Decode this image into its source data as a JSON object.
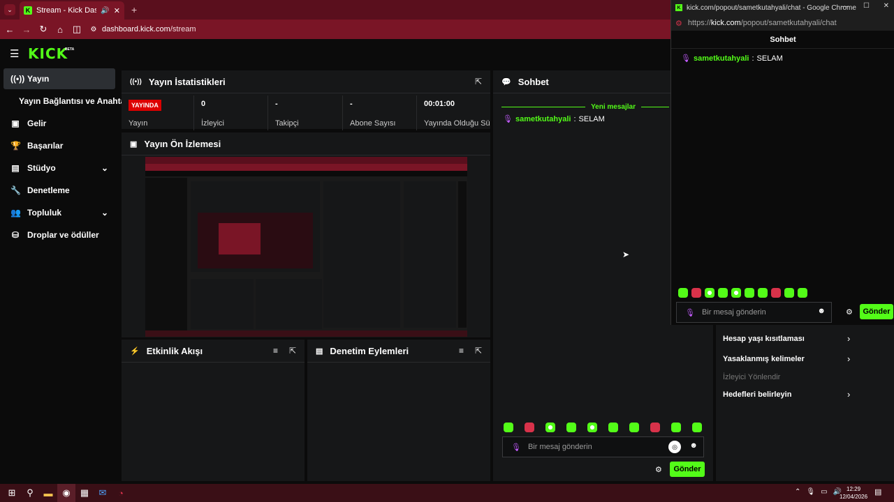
{
  "browser": {
    "tab_title": "Stream - Kick Dashboard",
    "url_domain": "dashboard.kick.com",
    "url_path": "/stream"
  },
  "popout": {
    "window_title": "kick.com/popout/sametkutahyali/chat - Google Chrome",
    "url_prefix": "https://",
    "url_domain": "kick.com",
    "url_path": "/popout/sametkutahyali/chat",
    "header": "Sohbet",
    "messages": [
      {
        "user": "sametkutahyali",
        "text": "SELAM"
      }
    ],
    "input_placeholder": "Bir mesaj gönderin",
    "send_label": "Gönder"
  },
  "header": {
    "logo": "KICK",
    "beta": "BETA"
  },
  "sidebar": {
    "items": [
      {
        "label": "Yayın",
        "icon": "broadcast-icon"
      },
      {
        "label": "Yayın Bağlantısı ve Anahtarı",
        "icon": ""
      },
      {
        "label": "Gelir",
        "icon": "revenue-icon"
      },
      {
        "label": "Başarılar",
        "icon": "trophy-icon"
      },
      {
        "label": "Stüdyo",
        "icon": "studio-icon"
      },
      {
        "label": "Denetleme",
        "icon": "moderation-icon"
      },
      {
        "label": "Topluluk",
        "icon": "community-icon"
      },
      {
        "label": "Droplar ve ödüller",
        "icon": "drops-icon"
      }
    ]
  },
  "stats": {
    "title": "Yayın İstatistikleri",
    "live_badge": "YAYINDA",
    "cells": [
      {
        "value": "",
        "label": "Yayın"
      },
      {
        "value": "0",
        "label": "İzleyici"
      },
      {
        "value": "-",
        "label": "Takipçi"
      },
      {
        "value": "-",
        "label": "Abone Sayısı"
      },
      {
        "value": "00:01:00",
        "label": "Yayında Olduğu Süre"
      }
    ]
  },
  "preview": {
    "title": "Yayın Ön İzlemesi"
  },
  "activity": {
    "title": "Etkinlik Akışı"
  },
  "modlog": {
    "title": "Denetim Eylemleri"
  },
  "chat": {
    "title": "Sohbet",
    "new_messages": "Yeni mesajlar",
    "messages": [
      {
        "user": "sametkutahyali",
        "text": "SELAM"
      }
    ],
    "input_placeholder": "Bir mesaj gönderin",
    "send_label": "Gönder"
  },
  "channel_actions": {
    "items": [
      {
        "label": "Hesap yaşı kısıtlaması",
        "enabled": true
      },
      {
        "label": "Yasaklanmış kelimeler",
        "enabled": true
      },
      {
        "label": "İzleyici Yönlendir",
        "enabled": false
      },
      {
        "label": "Hedefleri belirleyin",
        "enabled": true
      }
    ]
  },
  "taskbar": {
    "time": "12:29",
    "date": "12/04/2026"
  }
}
